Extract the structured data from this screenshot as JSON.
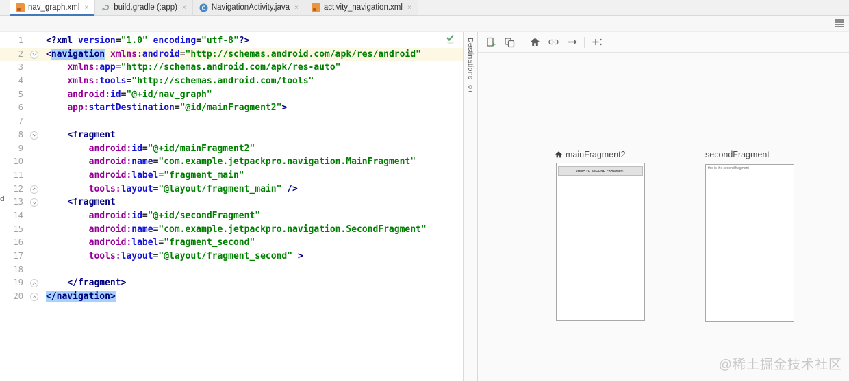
{
  "tabbar": {
    "close_glyph": "×",
    "tabs": [
      {
        "label": "nav_graph.xml",
        "icon": "xml-file-icon",
        "active": true
      },
      {
        "label": "build.gradle (:app)",
        "icon": "gradle-icon",
        "active": false
      },
      {
        "label": "NavigationActivity.java",
        "icon": "java-class-icon",
        "active": false
      },
      {
        "label": "activity_navigation.xml",
        "icon": "xml-file-icon",
        "active": false
      }
    ]
  },
  "editor": {
    "inspection_icon": "inspections-ok-green-check",
    "gutter_artifact": "d",
    "lines": [
      {
        "n": 1,
        "tokens": [
          [
            "<?xml",
            "pi"
          ],
          [
            " ",
            "pl"
          ],
          [
            "version",
            "attr"
          ],
          [
            "=",
            "pl"
          ],
          [
            "\"1.0\"",
            "val"
          ],
          [
            " ",
            "pl"
          ],
          [
            "encoding",
            "attr"
          ],
          [
            "=",
            "pl"
          ],
          [
            "\"utf-8\"",
            "val"
          ],
          [
            "?>",
            "pi"
          ]
        ]
      },
      {
        "n": 2,
        "current": true,
        "fold": "down",
        "tokens": [
          [
            "<",
            "tag"
          ],
          [
            "navigation",
            "tag sel"
          ],
          [
            " ",
            "pl"
          ],
          [
            "xmlns:",
            "ns"
          ],
          [
            "android",
            "attr"
          ],
          [
            "=",
            "pl"
          ],
          [
            "\"http://schemas.android.com/apk/res/android\"",
            "val"
          ]
        ]
      },
      {
        "n": 3,
        "tokens": [
          [
            "    ",
            "pl"
          ],
          [
            "xmlns:",
            "ns"
          ],
          [
            "app",
            "attr"
          ],
          [
            "=",
            "pl"
          ],
          [
            "\"http://schemas.android.com/apk/res-auto\"",
            "val"
          ]
        ]
      },
      {
        "n": 4,
        "tokens": [
          [
            "    ",
            "pl"
          ],
          [
            "xmlns:",
            "ns"
          ],
          [
            "tools",
            "attr"
          ],
          [
            "=",
            "pl"
          ],
          [
            "\"http://schemas.android.com/tools\"",
            "val"
          ]
        ]
      },
      {
        "n": 5,
        "tokens": [
          [
            "    ",
            "pl"
          ],
          [
            "android:",
            "ns"
          ],
          [
            "id",
            "attr"
          ],
          [
            "=",
            "pl"
          ],
          [
            "\"@+id/nav_graph\"",
            "val"
          ]
        ]
      },
      {
        "n": 6,
        "tokens": [
          [
            "    ",
            "pl"
          ],
          [
            "app:",
            "ns"
          ],
          [
            "startDestination",
            "attr"
          ],
          [
            "=",
            "pl"
          ],
          [
            "\"@id/mainFragment2\"",
            "val"
          ],
          [
            ">",
            "tag"
          ]
        ]
      },
      {
        "n": 7,
        "tokens": []
      },
      {
        "n": 8,
        "fold": "down",
        "tokens": [
          [
            "    ",
            "pl"
          ],
          [
            "<fragment",
            "tag"
          ]
        ]
      },
      {
        "n": 9,
        "tokens": [
          [
            "        ",
            "pl"
          ],
          [
            "android:",
            "ns"
          ],
          [
            "id",
            "attr"
          ],
          [
            "=",
            "pl"
          ],
          [
            "\"@+id/mainFragment2\"",
            "val"
          ]
        ]
      },
      {
        "n": 10,
        "tokens": [
          [
            "        ",
            "pl"
          ],
          [
            "android:",
            "ns"
          ],
          [
            "name",
            "attr"
          ],
          [
            "=",
            "pl"
          ],
          [
            "\"com.example.jetpackpro.navigation.MainFragment\"",
            "val"
          ]
        ]
      },
      {
        "n": 11,
        "tokens": [
          [
            "        ",
            "pl"
          ],
          [
            "android:",
            "ns"
          ],
          [
            "label",
            "attr"
          ],
          [
            "=",
            "pl"
          ],
          [
            "\"fragment_main\"",
            "val"
          ]
        ]
      },
      {
        "n": 12,
        "fold": "up",
        "tokens": [
          [
            "        ",
            "pl"
          ],
          [
            "tools:",
            "ns"
          ],
          [
            "layout",
            "attr"
          ],
          [
            "=",
            "pl"
          ],
          [
            "\"@layout/fragment_main\"",
            "val"
          ],
          [
            " />",
            "tag"
          ]
        ]
      },
      {
        "n": 13,
        "fold": "down",
        "tokens": [
          [
            "    ",
            "pl"
          ],
          [
            "<fragment",
            "tag"
          ]
        ]
      },
      {
        "n": 14,
        "tokens": [
          [
            "        ",
            "pl"
          ],
          [
            "android:",
            "ns"
          ],
          [
            "id",
            "attr"
          ],
          [
            "=",
            "pl"
          ],
          [
            "\"@+id/secondFragment\"",
            "val"
          ]
        ]
      },
      {
        "n": 15,
        "tokens": [
          [
            "        ",
            "pl"
          ],
          [
            "android:",
            "ns"
          ],
          [
            "name",
            "attr"
          ],
          [
            "=",
            "pl"
          ],
          [
            "\"com.example.jetpackpro.navigation.SecondFragment\"",
            "val"
          ]
        ]
      },
      {
        "n": 16,
        "tokens": [
          [
            "        ",
            "pl"
          ],
          [
            "android:",
            "ns"
          ],
          [
            "label",
            "attr"
          ],
          [
            "=",
            "pl"
          ],
          [
            "\"fragment_second\"",
            "val"
          ]
        ]
      },
      {
        "n": 17,
        "tokens": [
          [
            "        ",
            "pl"
          ],
          [
            "tools:",
            "ns"
          ],
          [
            "layout",
            "attr"
          ],
          [
            "=",
            "pl"
          ],
          [
            "\"@layout/fragment_second\"",
            "val"
          ],
          [
            " >",
            "tag"
          ]
        ]
      },
      {
        "n": 18,
        "tokens": []
      },
      {
        "n": 19,
        "fold": "up",
        "tokens": [
          [
            "    ",
            "pl"
          ],
          [
            "</fragment>",
            "tag"
          ]
        ]
      },
      {
        "n": 20,
        "fold": "up",
        "tokens": [
          [
            "</navigation>",
            "tag sel"
          ]
        ]
      }
    ]
  },
  "design": {
    "destinations_label": "Destinations",
    "toolbar_icons": [
      "new-destination-icon",
      "nested-graph-icon",
      "start-destination-home-icon",
      "deep-link-icon",
      "action-arrow-icon",
      "auto-arrange-icon"
    ],
    "previews": [
      {
        "label": "mainFragment2",
        "is_start_destination": true,
        "button_text": "JUMP TO SECOND FRAGMENT"
      },
      {
        "label": "secondFragment",
        "is_start_destination": false,
        "body_text": "this is the second fragment"
      }
    ]
  },
  "menu_icon": "hamburger-menu-icon",
  "watermark": {
    "text": "@稀土掘金技术社区"
  },
  "colors": {
    "accent_blue": "#4179be",
    "selection": "#a6d2ff",
    "current_line": "#fcf8e3",
    "xml_tag": "#000080",
    "xml_namespace": "#990099",
    "xml_attribute": "#1414d8",
    "xml_value": "#008000",
    "xml_icon_orange": "#e9973e",
    "java_icon_blue": "#4887c6",
    "check_green": "#59a869"
  }
}
